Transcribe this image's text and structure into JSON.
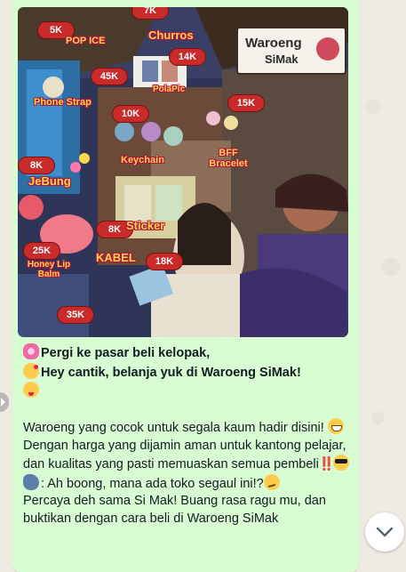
{
  "chat": {
    "message": {
      "image": {
        "shop_sign": {
          "line1": "Waroeng",
          "line2": "SiMak"
        },
        "items": [
          {
            "name": "POP ICE",
            "price": "5K"
          },
          {
            "name": "Churros",
            "price": "7K"
          },
          {
            "name": "PolaPic",
            "price": "14K"
          },
          {
            "name": "Phone Strap",
            "price": "45K"
          },
          {
            "name": "Keychain",
            "price": "10K"
          },
          {
            "name": "BFF Bracelet",
            "price": "15K"
          },
          {
            "name": "JeBung",
            "price": "8K"
          },
          {
            "name": "Sticker",
            "price": "8K"
          },
          {
            "name": "Honey Lip Balm",
            "price": "25K"
          },
          {
            "name": "KABEL",
            "price": "18K"
          },
          {
            "name": "",
            "price": "35K"
          }
        ]
      },
      "lines": {
        "l1": "Pergi ke pasar beli kelopak,",
        "l2": "Hey cantik, belanja yuk di Waroeng SiMak!",
        "p2a": "Waroeng yang cocok untuk segala kaum hadir disini!",
        "p2b": "Dengan harga yang dijamin aman untuk kantong pelajar, dan kualitas yang pasti memuaskan semua pembeli",
        "p2c": "‼️",
        "p3a": ": Ah boong, mana ada toko segaul ini!?",
        "p3b": "Percaya deh sama Si Mak! Buang rasa ragu mu, dan buktikan dengan cara beli di Waroeng SiMak"
      },
      "emojis": [
        "cherry-blossom",
        "face-blowing-kiss",
        "winking-face-tongue",
        "grinning-sweat",
        "smiling-sunglasses",
        "speaking-head",
        "smirking-face"
      ]
    },
    "scroll_button": {
      "icon": "chevron-down-icon"
    },
    "colors": {
      "bubble": "#d9fdd3",
      "background": "#efeae2",
      "price_tag": "#c92a2a"
    }
  }
}
